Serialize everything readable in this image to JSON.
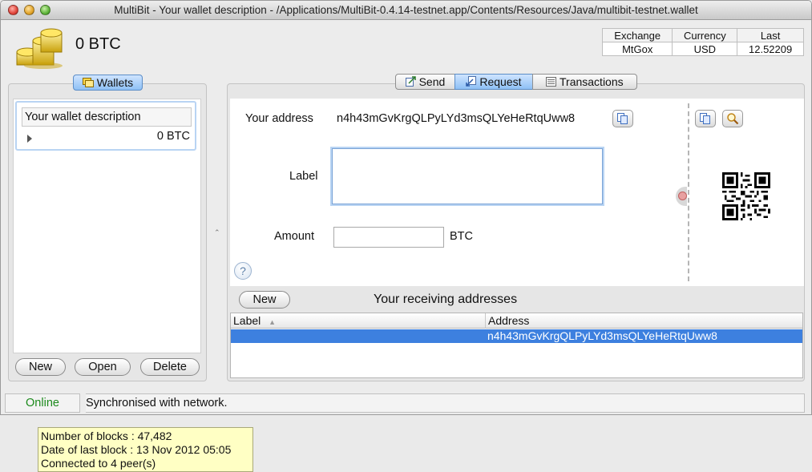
{
  "window": {
    "title": "MultiBit - Your wallet description - /Applications/MultiBit-0.4.14-testnet.app/Contents/Resources/Java/multibit-testnet.wallet"
  },
  "header": {
    "balance": "0 BTC",
    "ticker": {
      "headers": [
        "Exchange",
        "Currency",
        "Last"
      ],
      "values": [
        "MtGox",
        "USD",
        "12.52209"
      ]
    }
  },
  "wallets_panel": {
    "tab_label": "Wallets",
    "wallet": {
      "description": "Your wallet description",
      "balance": "0 BTC"
    },
    "buttons": {
      "new": "New",
      "open": "Open",
      "delete": "Delete"
    }
  },
  "tabs": {
    "send": "Send",
    "request": "Request",
    "transactions": "Transactions",
    "selected": "Request"
  },
  "request": {
    "address_label": "Your address",
    "address": "n4h43mGvKrgQLPyLYd3msQLYeHeRtqUww8",
    "label_label": "Label",
    "label_value": "",
    "amount_label": "Amount",
    "amount_value": "",
    "amount_unit": "BTC",
    "help_glyph": "?"
  },
  "receiving": {
    "new_button": "New",
    "title": "Your receiving addresses",
    "columns": [
      "Label",
      "Address"
    ],
    "rows": [
      {
        "label": "",
        "address": "n4h43mGvKrgQLPyLYd3msQLYeHeRtqUww8"
      }
    ]
  },
  "status": {
    "online": "Online",
    "message": "Synchronised with network.",
    "online_color": "#1c8a1c"
  },
  "tooltip": {
    "lines": [
      "Number of blocks : 47,482",
      "Date of last block : 13 Nov 2012 05:05",
      "Connected to 4 peer(s)"
    ]
  },
  "colors": {
    "selection": "#3d80df",
    "tooltip_bg": "#ffffc4",
    "selected_tab": "#8ec0f5"
  }
}
